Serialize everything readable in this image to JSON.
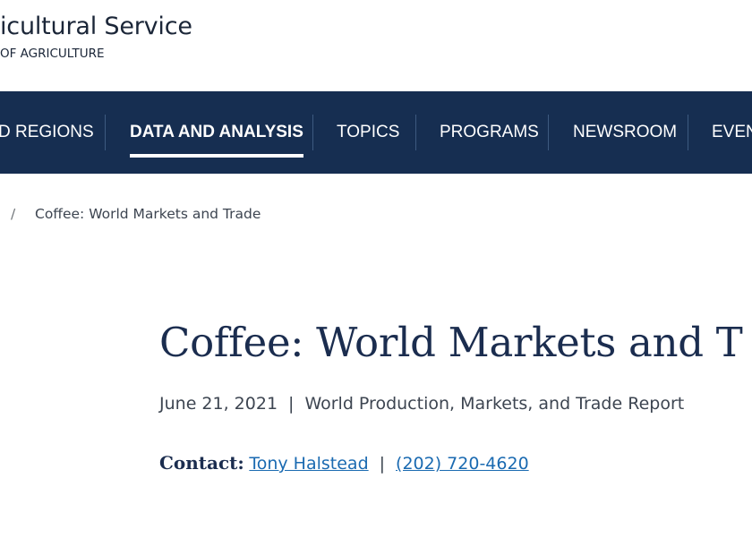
{
  "header": {
    "title": "icultural Service",
    "subtitle": "OF AGRICULTURE"
  },
  "nav": {
    "items": [
      {
        "label": "D REGIONS"
      },
      {
        "label": "DATA AND ANALYSIS",
        "active": true
      },
      {
        "label": "TOPICS"
      },
      {
        "label": "PROGRAMS"
      },
      {
        "label": "NEWSROOM"
      },
      {
        "label": "EVEN"
      }
    ]
  },
  "breadcrumb": {
    "separator": "/",
    "current": "Coffee: World Markets and Trade"
  },
  "main": {
    "title": "Coffee: World Markets and T",
    "date": "June 21, 2021",
    "meta_separator": "|",
    "report_type": "World Production, Markets, and Trade Report",
    "contact_label": "Contact:",
    "contact_name": "Tony Halstead",
    "contact_separator": "|",
    "contact_phone": "(202) 720-4620"
  },
  "colors": {
    "nav_background": "#162e51",
    "heading": "#1b2d4f",
    "link": "#1a6ab1",
    "body_text": "#3d4551"
  }
}
